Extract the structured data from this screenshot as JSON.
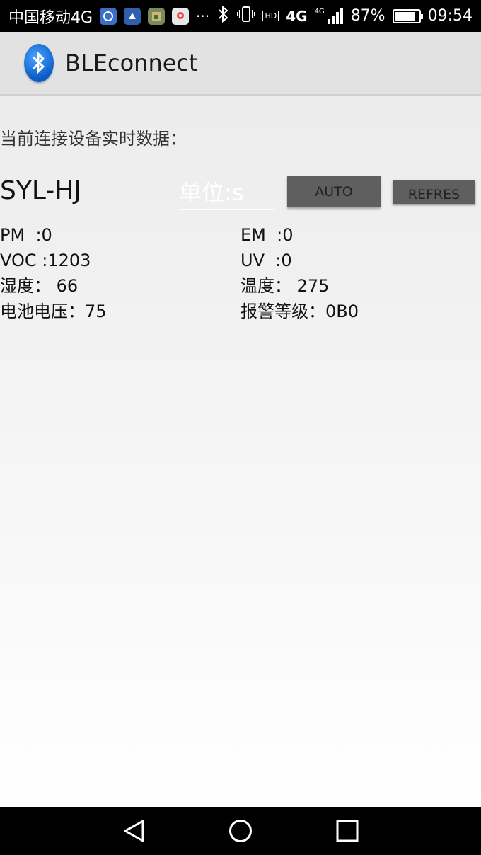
{
  "status_bar": {
    "carrier": "中国移动4G",
    "more": "···",
    "network": "4G",
    "network_small": "4G",
    "hd": "HD",
    "battery_percent": "87%",
    "battery_level": 0.87,
    "time": "09:54",
    "icons": [
      "app-notification-icon-1",
      "app-notification-icon-2",
      "gallery-icon",
      "map-icon",
      "bluetooth-icon",
      "vibrate-icon",
      "signal-icon",
      "battery-icon"
    ]
  },
  "app_bar": {
    "title": "BLEconnect",
    "logo_icon": "bluetooth-logo-icon"
  },
  "main": {
    "heading": "当前连接设备实时数据：",
    "device_name": "SYL-HJ",
    "unit_placeholder": "单位:s",
    "auto_label": "AUTO",
    "refresh_label": "REFRES",
    "readings": [
      {
        "text": "PM  :0"
      },
      {
        "text": "EM  :0"
      },
      {
        "text": "VOC :1203"
      },
      {
        "text": "UV  :0"
      },
      {
        "text": "湿度： 66"
      },
      {
        "text": "温度： 275"
      },
      {
        "text": "电池电压：75"
      },
      {
        "text": "报警等级：0B0"
      }
    ]
  },
  "nav_bar": {
    "back": "back-icon",
    "home": "home-icon",
    "recents": "recents-icon"
  }
}
